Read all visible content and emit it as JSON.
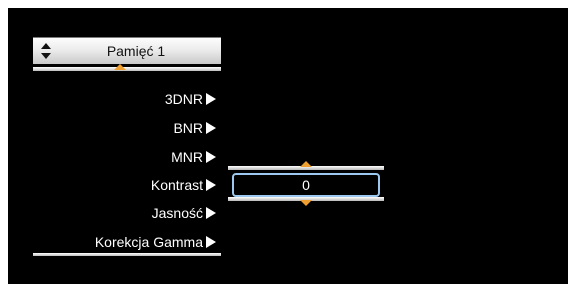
{
  "memory": {
    "label": "Pamięć 1",
    "selector_icon": "updown-arrows-icon"
  },
  "menu": {
    "items": [
      {
        "label": "3DNR",
        "icon": "arrow-right-icon"
      },
      {
        "label": "BNR",
        "icon": "arrow-right-icon"
      },
      {
        "label": "MNR",
        "icon": "arrow-right-icon"
      },
      {
        "label": "Kontrast",
        "icon": "arrow-right-icon"
      },
      {
        "label": "Jasność",
        "icon": "arrow-right-icon"
      },
      {
        "label": "Korekcja Gamma",
        "icon": "arrow-right-icon"
      }
    ]
  },
  "value_panel": {
    "value": "0",
    "up_icon": "caret-up-icon",
    "down_icon": "caret-down-icon"
  },
  "colors": {
    "background": "#000000",
    "accent_caret": "#f0a030",
    "field_border": "#9cc8f0"
  }
}
